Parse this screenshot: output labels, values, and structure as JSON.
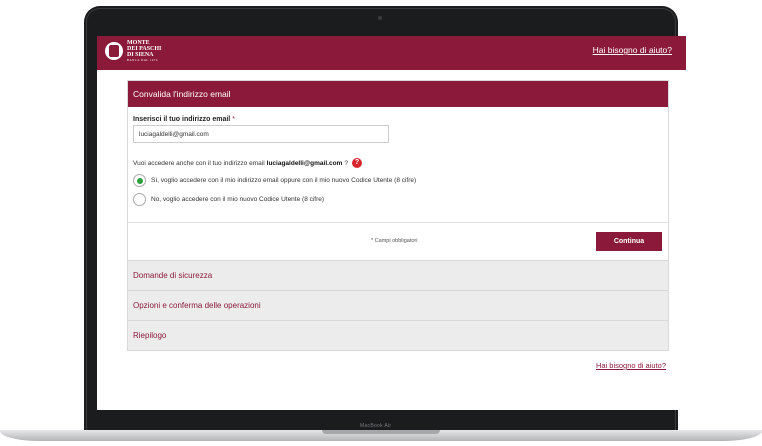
{
  "device": {
    "bezel_label": "MacBook Air"
  },
  "header": {
    "logo_line1": "MONTE",
    "logo_line2": "DEI PASCHI",
    "logo_line3": "DI SIENA",
    "logo_sub": "BANCA DAL 1472",
    "help_link": "Hai bisogno di aiuto?"
  },
  "email_step": {
    "title": "Convalida l'indirizzo email",
    "label": "Inserisci il tuo indirizzo email",
    "required_mark": "*",
    "email_value": "luciagaldelli@gmail.com",
    "question_prefix": "Vuoi accedere anche con il tuo indirizzo email",
    "question_email": "luciagaldelli@gmail.com",
    "question_suffix": "?",
    "help_icon": "?",
    "options": [
      {
        "label": "Sì, voglio accedere con il mio indirizzo email oppure con il mio nuovo Codice Utente (8 cifre)",
        "selected": true
      },
      {
        "label": "No, voglio accedere con il mio nuovo Codice Utente (8 cifre)",
        "selected": false
      }
    ],
    "required_note": "* Campi obbligatori",
    "continue_label": "Continua"
  },
  "steps": [
    {
      "label": "Domande di sicurezza"
    },
    {
      "label": "Opzioni e conferma delle operazioni"
    },
    {
      "label": "Riepilogo"
    }
  ],
  "footer": {
    "help_link": "Hai bisogno di aiuto?"
  },
  "colors": {
    "brand": "#8b1a3a",
    "selected_radio": "#2c9e3e",
    "help_icon": "#d9262e"
  }
}
